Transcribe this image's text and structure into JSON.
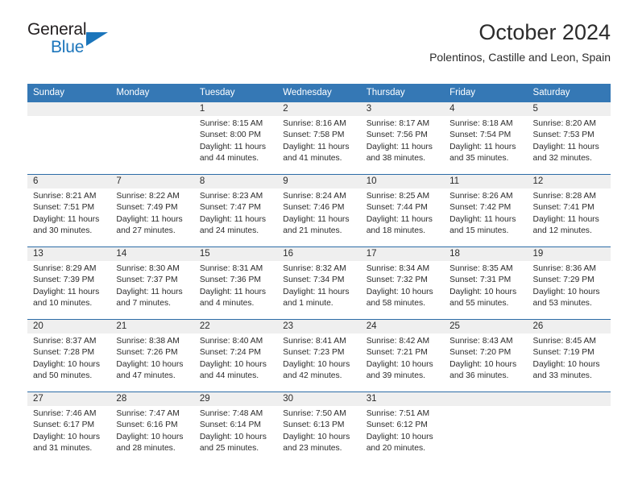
{
  "brand": {
    "name_part1": "General",
    "name_part2": "Blue",
    "accent_color": "#1b75bb"
  },
  "header": {
    "month_title": "October 2024",
    "location": "Polentinos, Castille and Leon, Spain"
  },
  "calendar": {
    "header_bg_color": "#3578b5",
    "day_band_color": "#efefef",
    "weekdays": [
      "Sunday",
      "Monday",
      "Tuesday",
      "Wednesday",
      "Thursday",
      "Friday",
      "Saturday"
    ],
    "weeks": [
      [
        {
          "day": "",
          "sunrise": "",
          "sunset": "",
          "daylight1": "",
          "daylight2": "",
          "empty": true
        },
        {
          "day": "",
          "sunrise": "",
          "sunset": "",
          "daylight1": "",
          "daylight2": "",
          "empty": true
        },
        {
          "day": "1",
          "sunrise": "Sunrise: 8:15 AM",
          "sunset": "Sunset: 8:00 PM",
          "daylight1": "Daylight: 11 hours",
          "daylight2": "and 44 minutes."
        },
        {
          "day": "2",
          "sunrise": "Sunrise: 8:16 AM",
          "sunset": "Sunset: 7:58 PM",
          "daylight1": "Daylight: 11 hours",
          "daylight2": "and 41 minutes."
        },
        {
          "day": "3",
          "sunrise": "Sunrise: 8:17 AM",
          "sunset": "Sunset: 7:56 PM",
          "daylight1": "Daylight: 11 hours",
          "daylight2": "and 38 minutes."
        },
        {
          "day": "4",
          "sunrise": "Sunrise: 8:18 AM",
          "sunset": "Sunset: 7:54 PM",
          "daylight1": "Daylight: 11 hours",
          "daylight2": "and 35 minutes."
        },
        {
          "day": "5",
          "sunrise": "Sunrise: 8:20 AM",
          "sunset": "Sunset: 7:53 PM",
          "daylight1": "Daylight: 11 hours",
          "daylight2": "and 32 minutes."
        }
      ],
      [
        {
          "day": "6",
          "sunrise": "Sunrise: 8:21 AM",
          "sunset": "Sunset: 7:51 PM",
          "daylight1": "Daylight: 11 hours",
          "daylight2": "and 30 minutes."
        },
        {
          "day": "7",
          "sunrise": "Sunrise: 8:22 AM",
          "sunset": "Sunset: 7:49 PM",
          "daylight1": "Daylight: 11 hours",
          "daylight2": "and 27 minutes."
        },
        {
          "day": "8",
          "sunrise": "Sunrise: 8:23 AM",
          "sunset": "Sunset: 7:47 PM",
          "daylight1": "Daylight: 11 hours",
          "daylight2": "and 24 minutes."
        },
        {
          "day": "9",
          "sunrise": "Sunrise: 8:24 AM",
          "sunset": "Sunset: 7:46 PM",
          "daylight1": "Daylight: 11 hours",
          "daylight2": "and 21 minutes."
        },
        {
          "day": "10",
          "sunrise": "Sunrise: 8:25 AM",
          "sunset": "Sunset: 7:44 PM",
          "daylight1": "Daylight: 11 hours",
          "daylight2": "and 18 minutes."
        },
        {
          "day": "11",
          "sunrise": "Sunrise: 8:26 AM",
          "sunset": "Sunset: 7:42 PM",
          "daylight1": "Daylight: 11 hours",
          "daylight2": "and 15 minutes."
        },
        {
          "day": "12",
          "sunrise": "Sunrise: 8:28 AM",
          "sunset": "Sunset: 7:41 PM",
          "daylight1": "Daylight: 11 hours",
          "daylight2": "and 12 minutes."
        }
      ],
      [
        {
          "day": "13",
          "sunrise": "Sunrise: 8:29 AM",
          "sunset": "Sunset: 7:39 PM",
          "daylight1": "Daylight: 11 hours",
          "daylight2": "and 10 minutes."
        },
        {
          "day": "14",
          "sunrise": "Sunrise: 8:30 AM",
          "sunset": "Sunset: 7:37 PM",
          "daylight1": "Daylight: 11 hours",
          "daylight2": "and 7 minutes."
        },
        {
          "day": "15",
          "sunrise": "Sunrise: 8:31 AM",
          "sunset": "Sunset: 7:36 PM",
          "daylight1": "Daylight: 11 hours",
          "daylight2": "and 4 minutes."
        },
        {
          "day": "16",
          "sunrise": "Sunrise: 8:32 AM",
          "sunset": "Sunset: 7:34 PM",
          "daylight1": "Daylight: 11 hours",
          "daylight2": "and 1 minute."
        },
        {
          "day": "17",
          "sunrise": "Sunrise: 8:34 AM",
          "sunset": "Sunset: 7:32 PM",
          "daylight1": "Daylight: 10 hours",
          "daylight2": "and 58 minutes."
        },
        {
          "day": "18",
          "sunrise": "Sunrise: 8:35 AM",
          "sunset": "Sunset: 7:31 PM",
          "daylight1": "Daylight: 10 hours",
          "daylight2": "and 55 minutes."
        },
        {
          "day": "19",
          "sunrise": "Sunrise: 8:36 AM",
          "sunset": "Sunset: 7:29 PM",
          "daylight1": "Daylight: 10 hours",
          "daylight2": "and 53 minutes."
        }
      ],
      [
        {
          "day": "20",
          "sunrise": "Sunrise: 8:37 AM",
          "sunset": "Sunset: 7:28 PM",
          "daylight1": "Daylight: 10 hours",
          "daylight2": "and 50 minutes."
        },
        {
          "day": "21",
          "sunrise": "Sunrise: 8:38 AM",
          "sunset": "Sunset: 7:26 PM",
          "daylight1": "Daylight: 10 hours",
          "daylight2": "and 47 minutes."
        },
        {
          "day": "22",
          "sunrise": "Sunrise: 8:40 AM",
          "sunset": "Sunset: 7:24 PM",
          "daylight1": "Daylight: 10 hours",
          "daylight2": "and 44 minutes."
        },
        {
          "day": "23",
          "sunrise": "Sunrise: 8:41 AM",
          "sunset": "Sunset: 7:23 PM",
          "daylight1": "Daylight: 10 hours",
          "daylight2": "and 42 minutes."
        },
        {
          "day": "24",
          "sunrise": "Sunrise: 8:42 AM",
          "sunset": "Sunset: 7:21 PM",
          "daylight1": "Daylight: 10 hours",
          "daylight2": "and 39 minutes."
        },
        {
          "day": "25",
          "sunrise": "Sunrise: 8:43 AM",
          "sunset": "Sunset: 7:20 PM",
          "daylight1": "Daylight: 10 hours",
          "daylight2": "and 36 minutes."
        },
        {
          "day": "26",
          "sunrise": "Sunrise: 8:45 AM",
          "sunset": "Sunset: 7:19 PM",
          "daylight1": "Daylight: 10 hours",
          "daylight2": "and 33 minutes."
        }
      ],
      [
        {
          "day": "27",
          "sunrise": "Sunrise: 7:46 AM",
          "sunset": "Sunset: 6:17 PM",
          "daylight1": "Daylight: 10 hours",
          "daylight2": "and 31 minutes."
        },
        {
          "day": "28",
          "sunrise": "Sunrise: 7:47 AM",
          "sunset": "Sunset: 6:16 PM",
          "daylight1": "Daylight: 10 hours",
          "daylight2": "and 28 minutes."
        },
        {
          "day": "29",
          "sunrise": "Sunrise: 7:48 AM",
          "sunset": "Sunset: 6:14 PM",
          "daylight1": "Daylight: 10 hours",
          "daylight2": "and 25 minutes."
        },
        {
          "day": "30",
          "sunrise": "Sunrise: 7:50 AM",
          "sunset": "Sunset: 6:13 PM",
          "daylight1": "Daylight: 10 hours",
          "daylight2": "and 23 minutes."
        },
        {
          "day": "31",
          "sunrise": "Sunrise: 7:51 AM",
          "sunset": "Sunset: 6:12 PM",
          "daylight1": "Daylight: 10 hours",
          "daylight2": "and 20 minutes."
        },
        {
          "day": "",
          "sunrise": "",
          "sunset": "",
          "daylight1": "",
          "daylight2": "",
          "empty": true
        },
        {
          "day": "",
          "sunrise": "",
          "sunset": "",
          "daylight1": "",
          "daylight2": "",
          "empty": true
        }
      ]
    ]
  }
}
